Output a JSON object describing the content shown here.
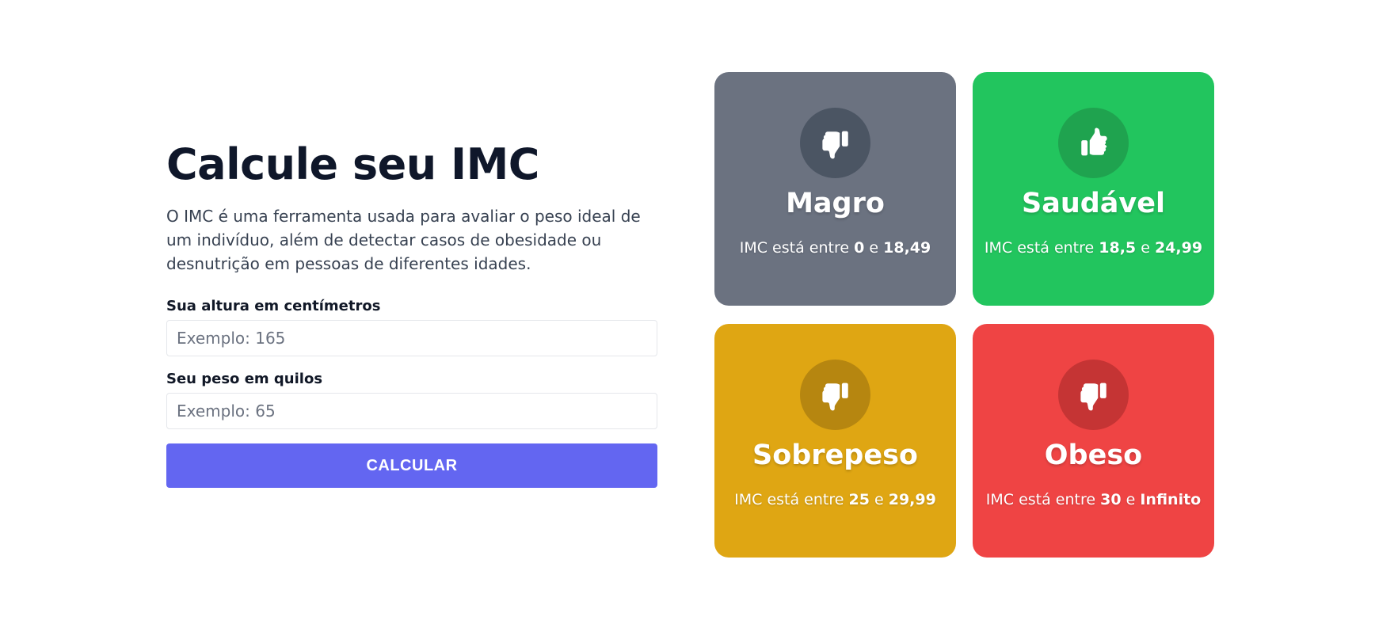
{
  "form": {
    "title": "Calcule seu IMC",
    "description": "O IMC é uma ferramenta usada para avaliar o peso ideal de um indivíduo, além de detectar casos de obesidade ou desnutrição em pessoas de diferentes idades.",
    "height_label": "Sua altura em centímetros",
    "height_placeholder": "Exemplo: 165",
    "height_value": "",
    "weight_label": "Seu peso em quilos",
    "weight_placeholder": "Exemplo: 65",
    "weight_value": "",
    "button_label": "CALCULAR"
  },
  "levels": [
    {
      "title": "Magro",
      "icon": "thumbs-down-icon",
      "color": "#6b7280",
      "icon_bg": "#4b5563",
      "range_prefix": "IMC está entre",
      "min": "0",
      "connector": "e",
      "max": "18,49"
    },
    {
      "title": "Saudável",
      "icon": "thumbs-up-icon",
      "color": "#22c55e",
      "icon_bg": "#1fa34f",
      "range_prefix": "IMC está entre",
      "min": "18,5",
      "connector": "e",
      "max": "24,99"
    },
    {
      "title": "Sobrepeso",
      "icon": "thumbs-down-icon",
      "color": "#dfa613",
      "icon_bg": "#b68610",
      "range_prefix": "IMC está entre",
      "min": "25",
      "connector": "e",
      "max": "29,99"
    },
    {
      "title": "Obeso",
      "icon": "thumbs-down-icon",
      "color": "#ef4444",
      "icon_bg": "#c53434",
      "range_prefix": "IMC está entre",
      "min": "30",
      "connector": "e",
      "max": "Infinito"
    }
  ]
}
